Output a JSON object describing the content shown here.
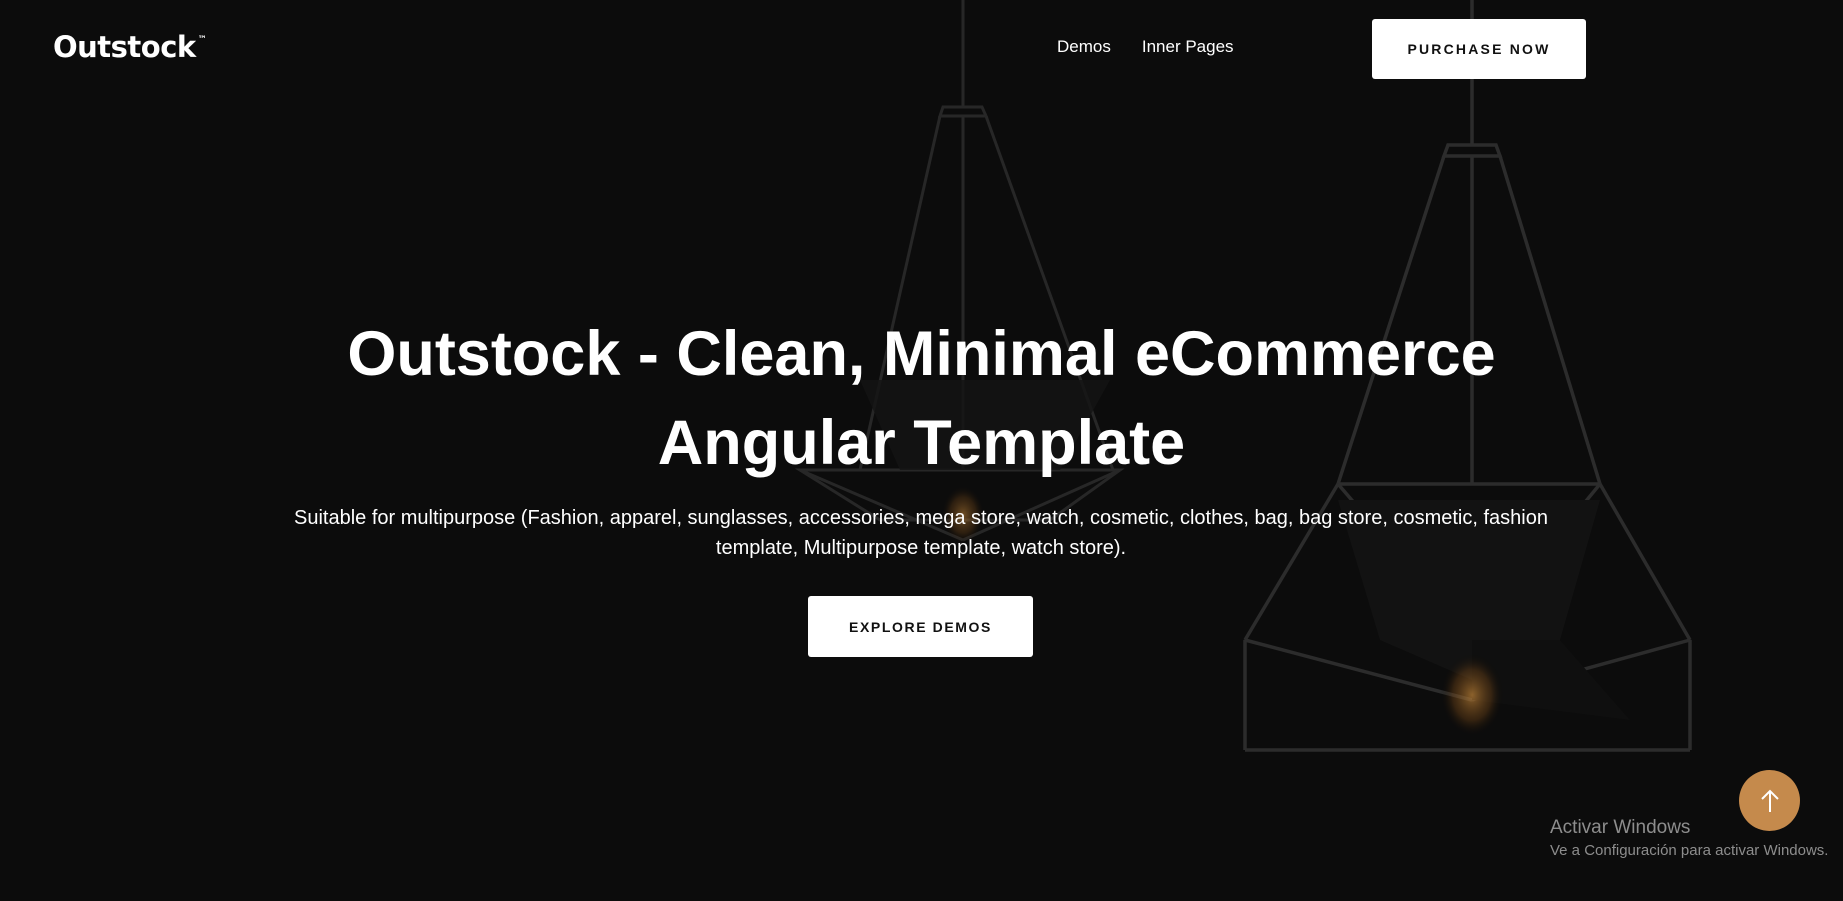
{
  "header": {
    "logo": "Outstock",
    "logo_mark": "™",
    "nav": [
      "Demos",
      "Inner Pages"
    ],
    "purchase_label": "PURCHASE NOW"
  },
  "hero": {
    "title_line1": "Outstock - Clean, Minimal eCommerce",
    "title_line2": "Angular Template",
    "subtitle": "Suitable for multipurpose (Fashion, apparel, sunglasses, accessories, mega store, watch, cosmetic, clothes, bag, bag store, cosmetic, fashion template, Multipurpose template, watch store).",
    "cta_label": "EXPLORE DEMOS"
  },
  "scroll_top": {
    "icon": "arrow-up-icon",
    "color": "#c58a4c"
  },
  "os_watermark": {
    "title": "Activar Windows",
    "subtitle": "Ve a Configuración para activar Windows."
  },
  "colors": {
    "background": "#0c0c0c",
    "button_bg": "#ffffff",
    "accent": "#c58a4c"
  }
}
